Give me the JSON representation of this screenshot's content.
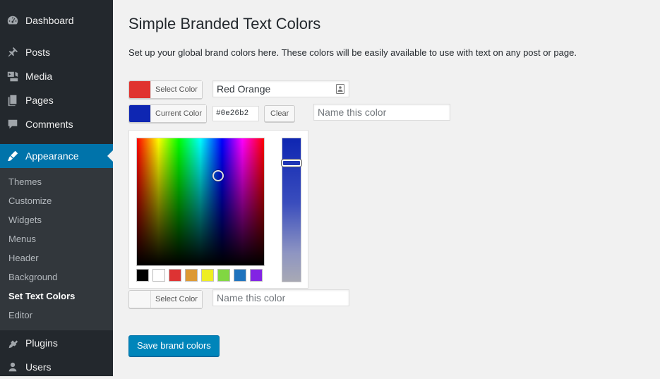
{
  "sidebar": {
    "items": [
      {
        "label": "Dashboard",
        "icon": "dashboard-icon"
      },
      {
        "label": "Posts",
        "icon": "pin-icon"
      },
      {
        "label": "Media",
        "icon": "media-icon"
      },
      {
        "label": "Pages",
        "icon": "pages-icon"
      },
      {
        "label": "Comments",
        "icon": "comment-icon"
      },
      {
        "label": "Appearance",
        "icon": "brush-icon"
      },
      {
        "label": "Plugins",
        "icon": "plugin-icon"
      },
      {
        "label": "Users",
        "icon": "user-icon"
      }
    ],
    "submenu": [
      {
        "label": "Themes"
      },
      {
        "label": "Customize"
      },
      {
        "label": "Widgets"
      },
      {
        "label": "Menus"
      },
      {
        "label": "Header"
      },
      {
        "label": "Background"
      },
      {
        "label": "Set Text Colors"
      },
      {
        "label": "Editor"
      }
    ]
  },
  "main": {
    "title": "Simple Branded Text Colors",
    "description": "Set up your global brand colors here. These colors will be easily available to use with text on any post or page.",
    "rows": [
      {
        "button_label": "Select Color",
        "swatch": "#e0332f",
        "name_value": "Red Orange"
      },
      {
        "button_label": "Current Color",
        "swatch": "#0e26b2",
        "hex_value": "#0e26b2",
        "clear_label": "Clear",
        "name_placeholder": "Name this color"
      },
      {
        "button_label": "Select Color",
        "swatch": "#f7f7f7",
        "name_placeholder": "Name this color"
      }
    ],
    "palette": [
      "#000000",
      "#ffffff",
      "#dd3333",
      "#dd9933",
      "#eeee22",
      "#81d742",
      "#1e73be",
      "#8224e3"
    ],
    "save_label": "Save brand colors"
  },
  "colors": {
    "sidebar_bg": "#23282d",
    "active": "#0073aa",
    "primary_button": "#0085ba"
  }
}
